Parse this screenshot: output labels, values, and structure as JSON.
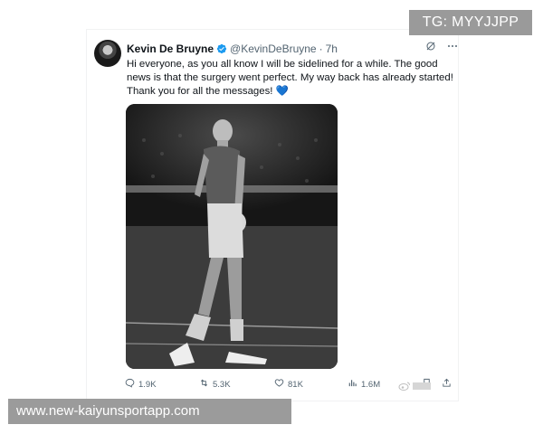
{
  "tweet": {
    "author_name": "Kevin De Bruyne",
    "handle": "@KevinDeBruyne",
    "separator": "·",
    "time": "7h",
    "text": "Hi everyone, as you all know I will be sidelined for a while. The good news is that the surgery went perfect. My way back has already started! Thank you for all the messages!",
    "emoji": "💙",
    "verified_color": "#1d9bf0",
    "top_icons": [
      "grok-icon",
      "more-icon"
    ]
  },
  "actions": {
    "replies": "1.9K",
    "reposts": "5.3K",
    "likes": "81K",
    "views": "1.6M",
    "icons": [
      "reply-icon",
      "repost-icon",
      "like-icon",
      "views-icon",
      "bookmark-icon",
      "share-icon"
    ]
  },
  "overlays": {
    "telegram": "TG: MYYJJPP",
    "website": "www.new-kaiyunsportapp.com"
  }
}
